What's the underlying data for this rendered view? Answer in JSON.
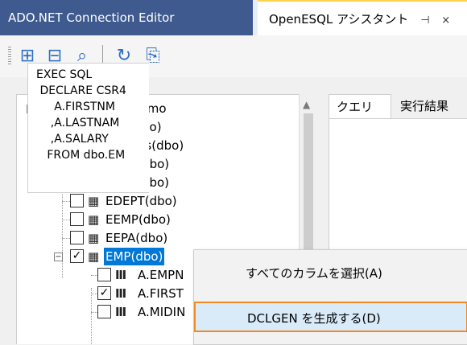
{
  "tabs": [
    {
      "label": "ADO.NET Connection Editor"
    },
    {
      "label": "OpenESQL アシスタント",
      "pin": "⊣",
      "close": "×"
    }
  ],
  "toolbar": {
    "icons": [
      "add-table-icon",
      "remove-table-icon",
      "search-icon",
      "refresh-icon",
      "clear-icon"
    ],
    "glyphs": [
      "⊞",
      "⊟",
      "⌕",
      "↻",
      "⎘"
    ]
  },
  "tree": {
    "root": {
      "label": "OESQLDemo",
      "checked": true
    },
    "tables": [
      {
        "label": "ACT(dbo)",
        "checked": false
      },
      {
        "label": "authors(dbo)",
        "checked": false
      },
      {
        "label": "DEPT(dbo)",
        "checked": false
      },
      {
        "label": "EACT(dbo)",
        "checked": false
      },
      {
        "label": "EDEPT(dbo)",
        "checked": false
      },
      {
        "label": "EEMP(dbo)",
        "checked": false
      },
      {
        "label": "EEPA(dbo)",
        "checked": false
      },
      {
        "label": "EMP(dbo)",
        "checked": true,
        "selected": true
      }
    ],
    "columns": [
      {
        "label": "A.EMPN",
        "checked": false
      },
      {
        "label": "A.FIRST",
        "checked": true
      },
      {
        "label": "A.MIDIN",
        "checked": false
      }
    ],
    "selection_color": "#0078d7"
  },
  "right": {
    "tabs": [
      {
        "label": "クエリー"
      },
      {
        "label": "実行結果"
      }
    ],
    "sql_lines": [
      "EXEC SQL",
      " DECLARE CSR4",
      "     A.FIRSTNM",
      "    ,A.LASTNAM",
      "    ,A.SALARY",
      "   FROM dbo.EM"
    ]
  },
  "context_menu": {
    "items": [
      {
        "label": "すべてのカラムを選択(A)"
      },
      {
        "label": "DCLGEN を生成する(D)",
        "highlighted": true
      }
    ],
    "highlight_border": "#f08a24"
  }
}
